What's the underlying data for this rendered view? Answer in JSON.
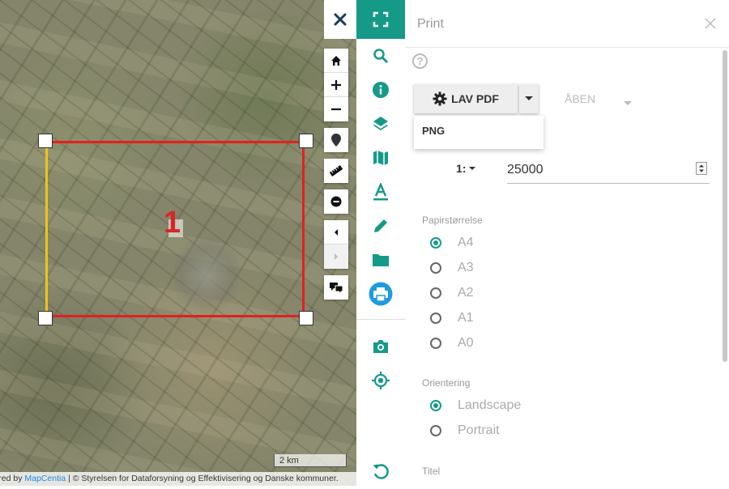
{
  "map": {
    "scale_bar_label": "2 km",
    "print_frame_page_number": "1",
    "attribution": {
      "prefix": "Powered by ",
      "link_text": "MapCentia",
      "rest": " | © Styrelsen for Dataforsyning og Effektivisering og Danske kommuner."
    }
  },
  "map_tools": [
    "home-icon",
    "zoom-in-icon",
    "zoom-out-icon",
    "location-pin-icon",
    "ruler-icon",
    "minus-circle-icon",
    "previous-extent-icon",
    "next-extent-icon",
    "fullscreen-icon"
  ],
  "rail": {
    "items": [
      "search-icon",
      "info-icon",
      "layers-icon",
      "map-icon",
      "text-icon",
      "pencil-icon",
      "folder-icon",
      "print-icon",
      "camera-icon",
      "locate-icon",
      "reset-icon"
    ],
    "active": "print-icon",
    "accent": "#159a88"
  },
  "panel": {
    "title": "Print",
    "primary_button": "LAV PDF",
    "secondary_button": "ÅBEN",
    "dropdown_items": [
      "PNG"
    ],
    "scale_prefix": "1:",
    "scale_value": "25000",
    "paper_size_label": "Papirstørrelse",
    "paper_sizes": [
      "A4",
      "A3",
      "A2",
      "A1",
      "A0"
    ],
    "paper_size_selected": "A4",
    "orientation_label": "Orientering",
    "orientations": [
      "Landscape",
      "Portrait"
    ],
    "orientation_selected": "Landscape",
    "title_label": "Titel"
  }
}
